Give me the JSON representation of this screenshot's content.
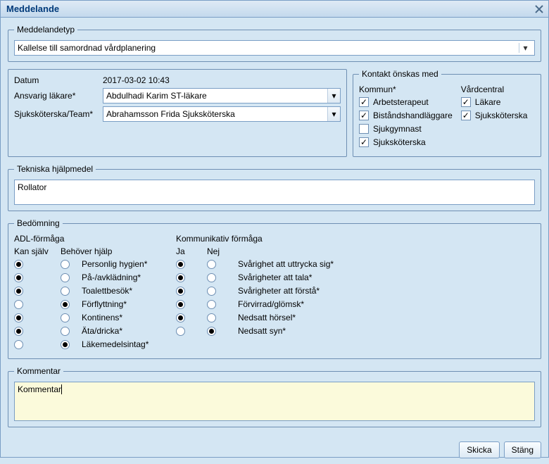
{
  "window": {
    "title": "Meddelande"
  },
  "meddelandetyp": {
    "legend": "Meddelandetyp",
    "value": "Kallelse till samordnad vårdplanering"
  },
  "datum": {
    "label": "Datum",
    "value": "2017-03-02 10:43"
  },
  "ansvarig": {
    "label": "Ansvarig läkare*",
    "value": "Abdulhadi Karim ST-läkare"
  },
  "sjukskoterska": {
    "label": "Sjuksköterska/Team*",
    "value": "Abrahamsson Frida Sjuksköterska"
  },
  "kontakt": {
    "legend": "Kontakt önskas med",
    "kommun": {
      "label": "Kommun*",
      "items": [
        {
          "label": "Arbetsterapeut",
          "checked": true
        },
        {
          "label": "Biståndshandläggare",
          "checked": true
        },
        {
          "label": "Sjukgymnast",
          "checked": false
        },
        {
          "label": "Sjuksköterska",
          "checked": true
        }
      ]
    },
    "vardcentral": {
      "label": "Vårdcentral",
      "items": [
        {
          "label": "Läkare",
          "checked": true
        },
        {
          "label": "Sjuksköterska",
          "checked": true
        }
      ]
    }
  },
  "tekniska": {
    "legend": "Tekniska hjälpmedel",
    "value": "Rollator"
  },
  "bedomning": {
    "legend": "Bedömning",
    "adl": {
      "label": "ADL-förmåga",
      "col1": "Kan själv",
      "col2": "Behöver hjälp",
      "rows": [
        {
          "label": "Personlig hygien*",
          "sel": 0
        },
        {
          "label": "På-/avklädning*",
          "sel": 0
        },
        {
          "label": "Toalettbesök*",
          "sel": 0
        },
        {
          "label": "Förflyttning*",
          "sel": 1
        },
        {
          "label": "Kontinens*",
          "sel": 0
        },
        {
          "label": "Äta/dricka*",
          "sel": 0
        },
        {
          "label": "Läkemedelsintag*",
          "sel": 1
        }
      ]
    },
    "komm": {
      "label": "Kommunikativ förmåga",
      "col1": "Ja",
      "col2": "Nej",
      "rows": [
        {
          "label": "Svårighet att uttrycka sig*",
          "sel": 0
        },
        {
          "label": "Svårigheter att tala*",
          "sel": 0
        },
        {
          "label": "Svårigheter att förstå*",
          "sel": 0
        },
        {
          "label": "Förvirrad/glömsk*",
          "sel": 0
        },
        {
          "label": "Nedsatt hörsel*",
          "sel": 0
        },
        {
          "label": "Nedsatt syn*",
          "sel": 1
        }
      ]
    }
  },
  "kommentar": {
    "legend": "Kommentar",
    "value": "Kommentar"
  },
  "buttons": {
    "send": "Skicka",
    "close": "Stäng"
  }
}
